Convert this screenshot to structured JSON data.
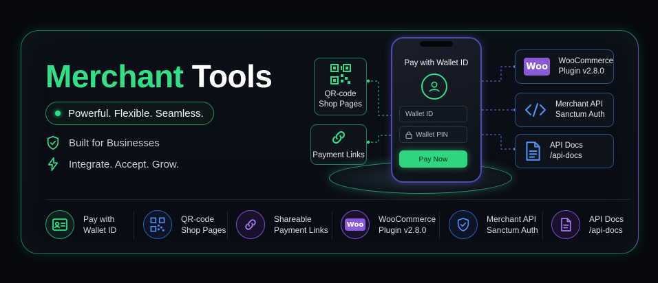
{
  "hero": {
    "title_accent": "Merchant",
    "title_rest": "Tools",
    "tagline": "Powerful. Flexible. Seamless.",
    "features": [
      {
        "icon": "shield-check-icon",
        "label": "Built for Businesses"
      },
      {
        "icon": "lightning-icon",
        "label": "Integrate. Accept. Grow."
      }
    ]
  },
  "phone": {
    "title": "Pay with Wallet ID",
    "avatar_icon": "user-icon",
    "wallet_id_placeholder": "Wallet ID",
    "wallet_pin_placeholder": "Wallet PIN",
    "pay_button": "Pay Now"
  },
  "left_cards": [
    {
      "icon": "qr-code-icon",
      "line1": "QR-code",
      "line2": "Shop Pages"
    },
    {
      "icon": "link-icon",
      "line1": "Payment Links"
    }
  ],
  "right_cards": [
    {
      "icon": "woo-logo-icon",
      "logo_text": "Woo",
      "line1": "WooCommerce",
      "line2": "Plugin v2.8.0"
    },
    {
      "icon": "code-icon",
      "line1": "Merchant API",
      "line2": "Sanctum Auth"
    },
    {
      "icon": "document-icon",
      "line1": "API Docs",
      "line2": "/api-docs"
    }
  ],
  "bottom_features": [
    {
      "icon": "wallet-id-card-icon",
      "line1": "Pay with",
      "line2": "Wallet ID"
    },
    {
      "icon": "qr-code-icon",
      "line1": "QR-code",
      "line2": "Shop Pages"
    },
    {
      "icon": "link-icon",
      "line1": "Shareable",
      "line2": "Payment Links"
    },
    {
      "icon": "woo-logo-icon",
      "logo_text": "Woo",
      "line1": "WooCommerce",
      "line2": "Plugin v2.8.0"
    },
    {
      "icon": "shield-check-icon",
      "line1": "Merchant API",
      "line2": "Sanctum Auth"
    },
    {
      "icon": "document-icon",
      "line1": "API Docs",
      "line2": "/api-docs"
    }
  ],
  "colors": {
    "accent_green": "#2fe086",
    "accent_blue": "#2f5fb3",
    "accent_purple": "#7a4fd0",
    "woo_purple": "#8a5ad9",
    "background": "#07080d"
  }
}
